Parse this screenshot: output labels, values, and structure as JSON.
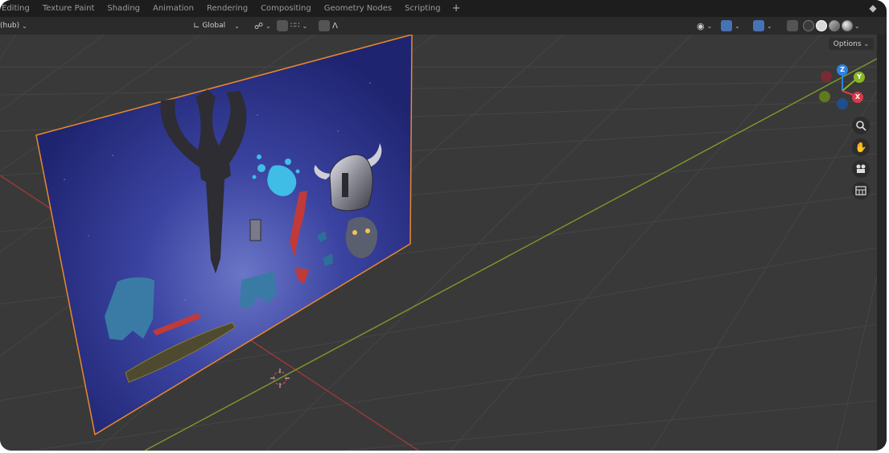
{
  "workspace_tabs": [
    "Editing",
    "Texture Paint",
    "Shading",
    "Animation",
    "Rendering",
    "Compositing",
    "Geometry Nodes",
    "Scripting"
  ],
  "add_tab_label": "+",
  "header": {
    "mode_label": "(hub)",
    "transform_orientation": "Global",
    "snap_value": "",
    "options_label": "Options"
  },
  "gizmo": {
    "z": "Z",
    "y": "Y",
    "x": "X"
  },
  "colors": {
    "accent": "#4772b3",
    "x_axis": "#d83a48",
    "y_axis": "#8ab624",
    "z_axis": "#2f83e0",
    "plane_outline": "#e8882e",
    "plane_fill": "#2d3585"
  },
  "icons": {
    "zoom": "magnifier-icon",
    "pan": "hand-icon",
    "camera": "camera-icon",
    "perspective": "grid-ortho-icon"
  }
}
